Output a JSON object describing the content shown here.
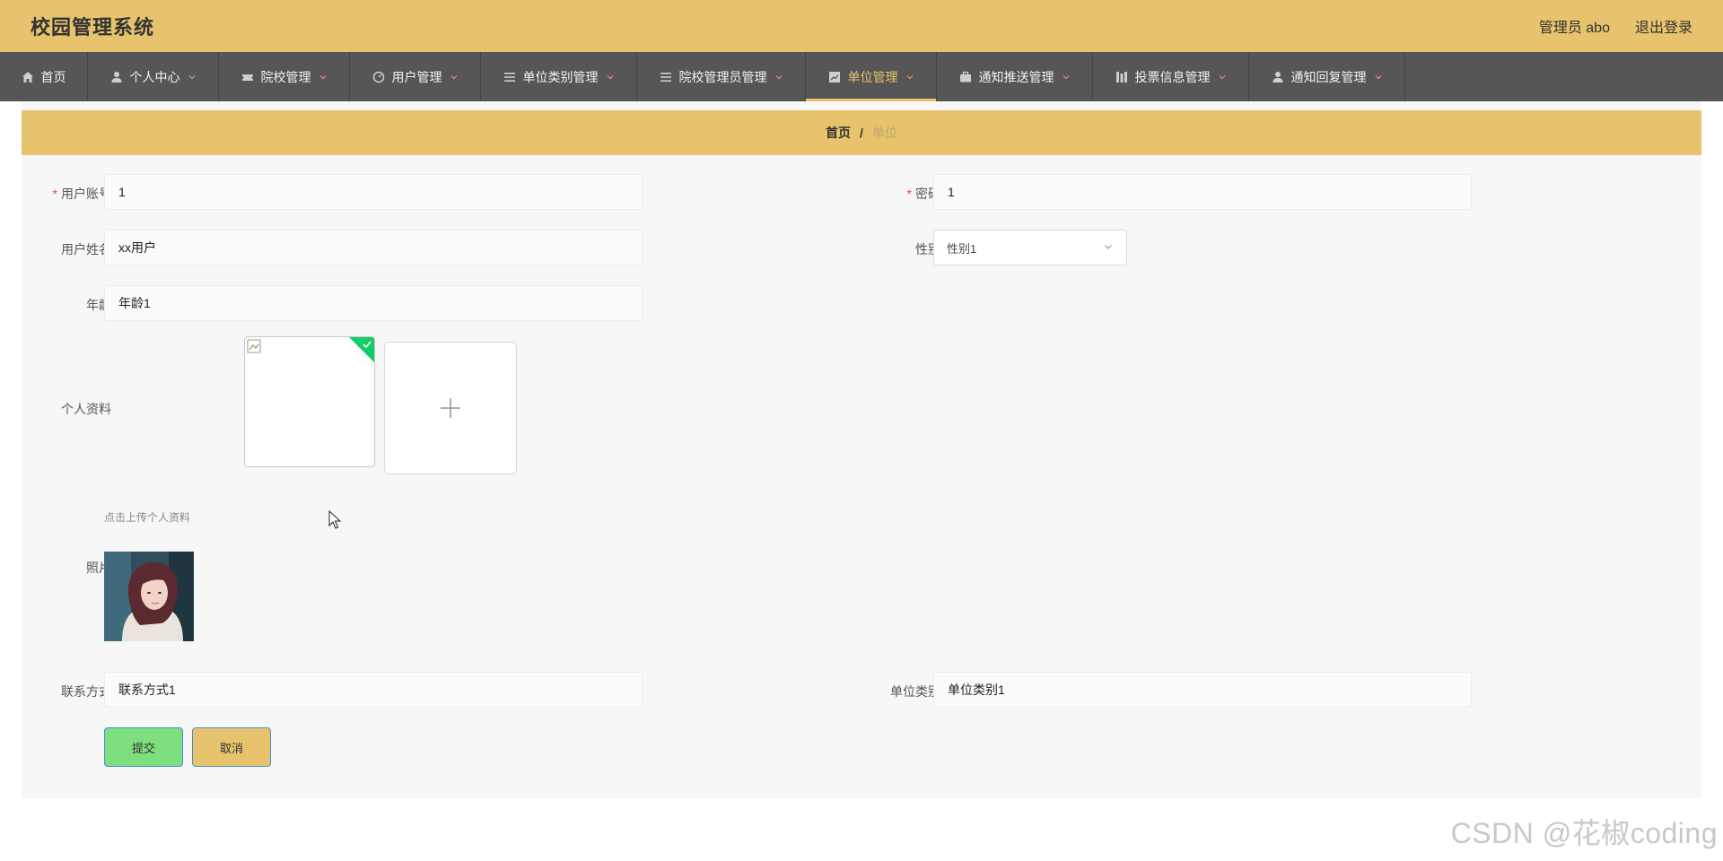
{
  "header": {
    "title": "校园管理系统",
    "user": "管理员 abo",
    "logout": "退出登录"
  },
  "nav": {
    "items": [
      {
        "label": "首页",
        "icon": "home-icon"
      },
      {
        "label": "个人中心",
        "icon": "user-icon"
      },
      {
        "label": "院校管理",
        "icon": "ticket-icon"
      },
      {
        "label": "用户管理",
        "icon": "gauge-icon"
      },
      {
        "label": "单位类别管理",
        "icon": "list-icon"
      },
      {
        "label": "院校管理员管理",
        "icon": "list-icon"
      },
      {
        "label": "单位管理",
        "icon": "chart-icon",
        "active": true
      },
      {
        "label": "通知推送管理",
        "icon": "briefcase-icon"
      },
      {
        "label": "投票信息管理",
        "icon": "columns-icon"
      },
      {
        "label": "通知回复管理",
        "icon": "user-icon"
      }
    ]
  },
  "breadcrumb": {
    "home": "首页",
    "separator": "/",
    "current": "单位"
  },
  "form": {
    "account": {
      "label": "用户账号",
      "value": "1"
    },
    "password": {
      "label": "密码",
      "value": "1"
    },
    "name": {
      "label": "用户姓名",
      "value": "xx用户"
    },
    "gender": {
      "label": "性别",
      "value": "性别1"
    },
    "age": {
      "label": "年龄",
      "value": "年龄1"
    },
    "profile": {
      "label": "个人资料",
      "hint": "点击上传个人资料"
    },
    "photo": {
      "label": "照片"
    },
    "contact": {
      "label": "联系方式",
      "value": "联系方式1"
    },
    "unit_type": {
      "label": "单位类别",
      "value": "单位类别1"
    }
  },
  "actions": {
    "submit": "提交",
    "cancel": "取消"
  },
  "watermark": "CSDN @花椒coding",
  "colors": {
    "accent": "#e6c36c",
    "nav": "#565656",
    "success": "#13ce66",
    "submit": "#7ddf7e"
  }
}
